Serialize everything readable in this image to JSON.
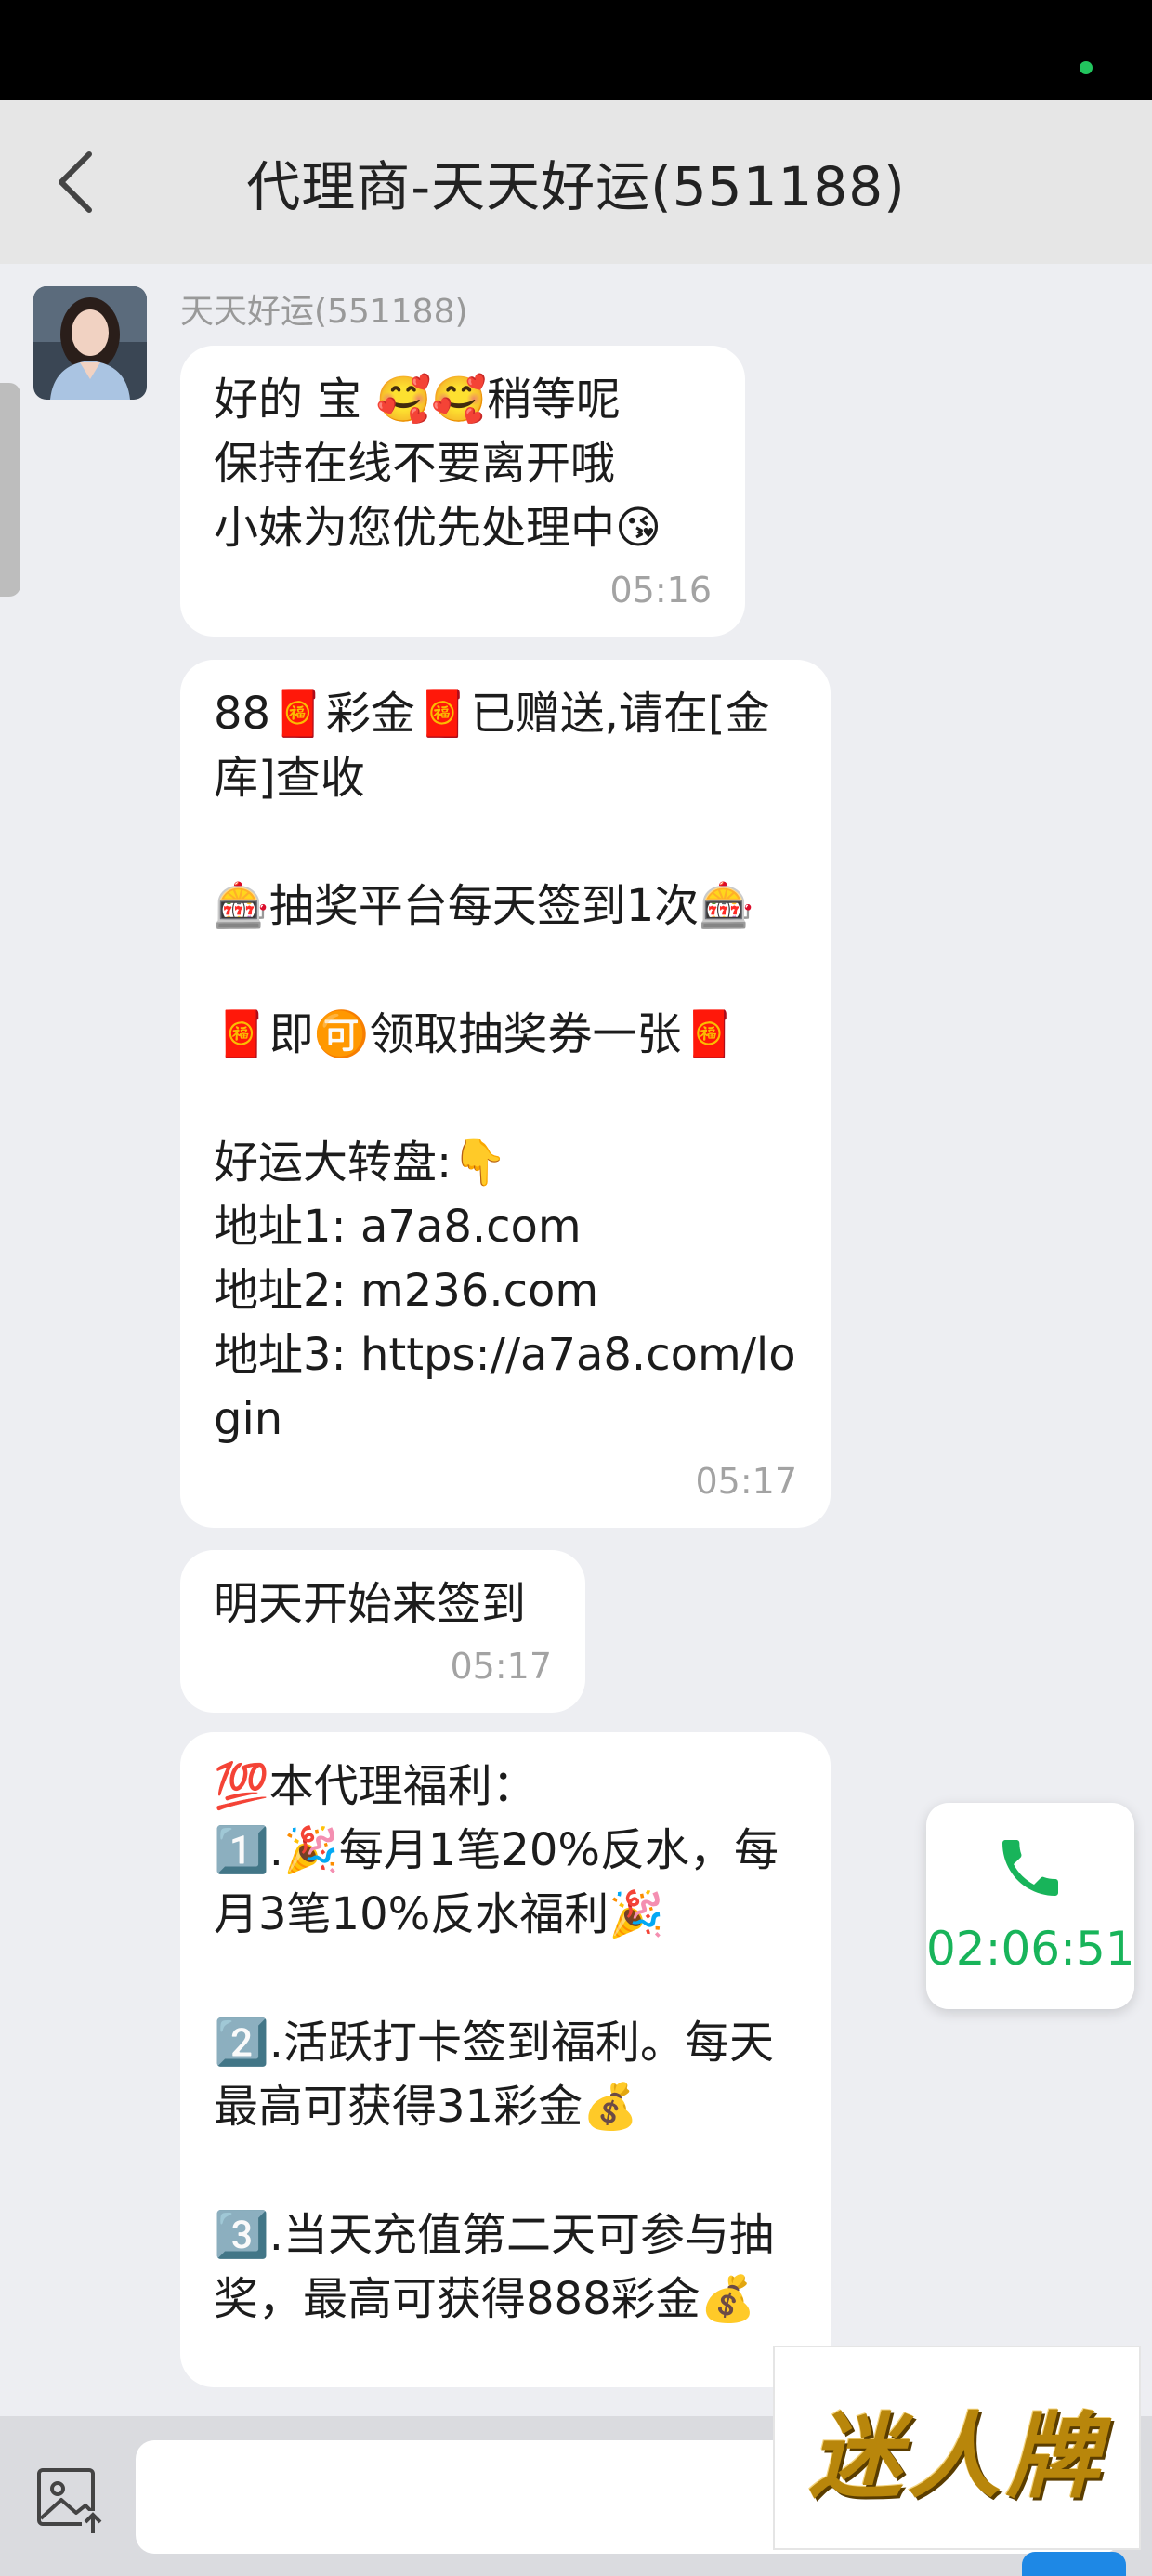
{
  "header": {
    "title": "代理商-天天好运(551188)"
  },
  "chat": {
    "sender_name": "天天好运(551188)",
    "messages": [
      {
        "text": "好的 宝 🥰🥰稍等呢\n保持在线不要离开哦\n小妹为您优先处理中😘",
        "time": "05:16"
      },
      {
        "text": "88🧧彩金🧧已赠送,请在[金库]查收\n\n🎰抽奖平台每天签到1次🎰\n\n🧧即🉑领取抽奖券一张🧧\n\n好运大转盘:👇\n地址1: a7a8.com\n地址2: m236.com\n地址3: https://a7a8.com/login",
        "time": "05:17"
      },
      {
        "text": "明天开始来签到",
        "time": "05:17"
      },
      {
        "text": "💯本代理福利：\n1️⃣.🎉每月1笔20%反水，每月3笔10%反水福利🎉\n\n2️⃣.活跃打卡签到福利。每天最高可获得31彩金💰\n\n3️⃣.当天充值第二天可参与抽奖，最高可获得888彩金💰"
      }
    ]
  },
  "call": {
    "timer": "02:06:51",
    "accent": "#18b45a"
  },
  "input": {
    "placeholder": ""
  },
  "watermark": {
    "text": "迷人牌"
  },
  "icons": {
    "back": "chevron-left-icon",
    "phone": "phone-icon",
    "image": "image-upload-icon"
  }
}
